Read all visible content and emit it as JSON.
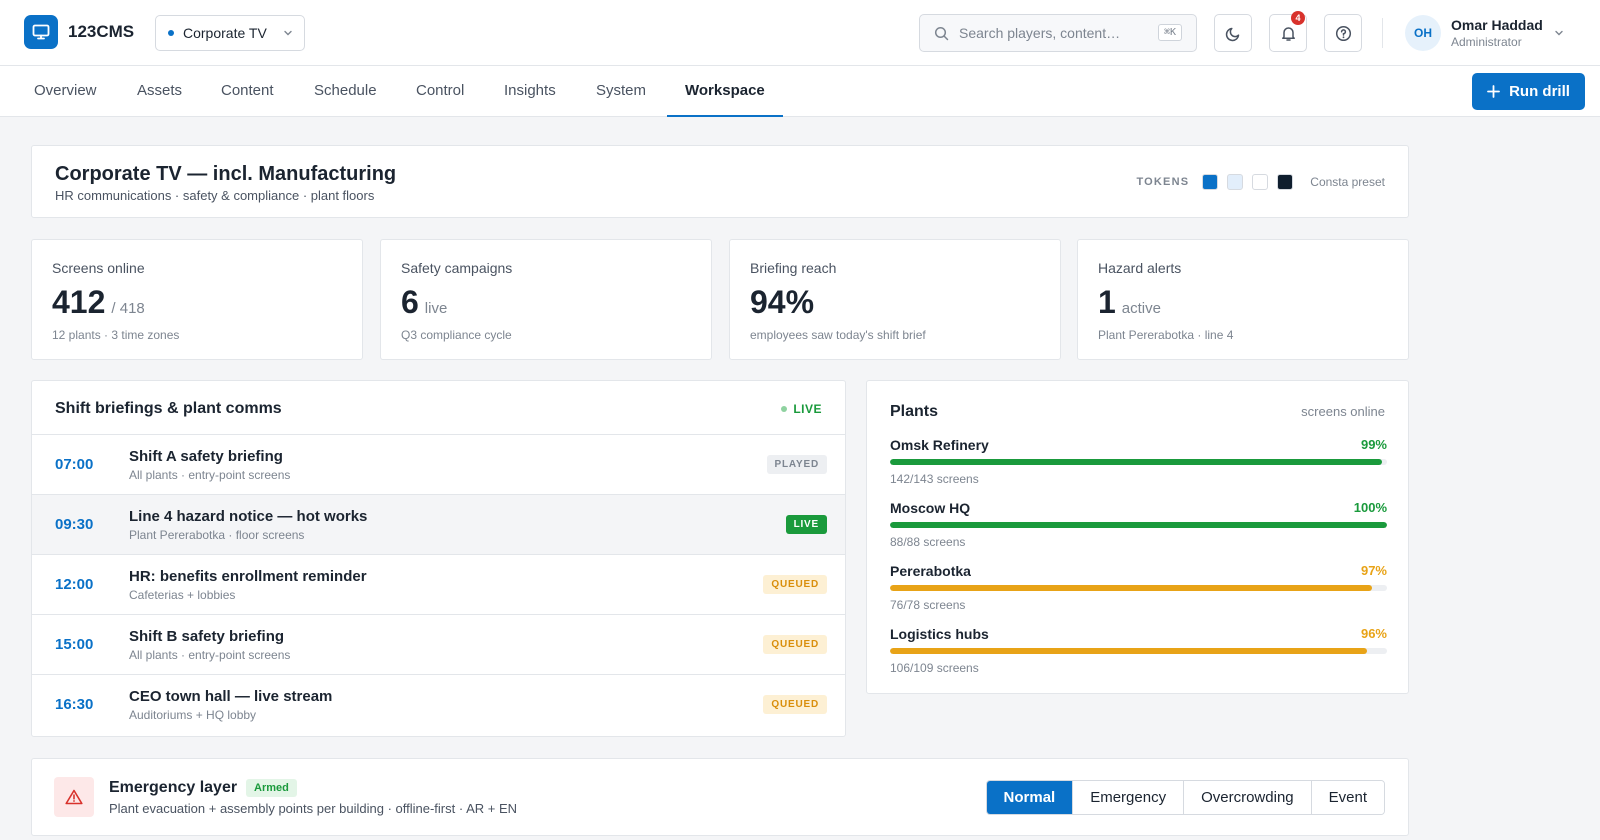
{
  "header": {
    "brand": "123CMS",
    "workspace": "Corporate TV",
    "search_placeholder": "Search players, content…",
    "search_shortcut": "⌘K",
    "notifications_count": "4",
    "user": {
      "initials": "OH",
      "name": "Omar Haddad",
      "role": "Administrator"
    }
  },
  "nav": {
    "tabs": [
      "Overview",
      "Assets",
      "Content",
      "Schedule",
      "Control",
      "Insights",
      "System",
      "Workspace"
    ],
    "active": "Workspace",
    "run_drill": "Run drill"
  },
  "workspace": {
    "title": "Corporate TV — incl. Manufacturing",
    "subtitle": "HR communications · safety & compliance · plant floors",
    "tokens_label": "TOKENS",
    "token_colors": [
      "#0a71c7",
      "#e2eefb",
      "#ffffff",
      "#0f1e2e"
    ],
    "preset": "Consta preset"
  },
  "stats": [
    {
      "label": "Screens online",
      "value": "412",
      "unit": "/ 418",
      "note": "12 plants · 3 time zones"
    },
    {
      "label": "Safety campaigns",
      "value": "6",
      "unit": "live",
      "note": "Q3 compliance cycle"
    },
    {
      "label": "Briefing reach",
      "value": "94%",
      "unit": "",
      "note": "employees saw today's shift brief"
    },
    {
      "label": "Hazard alerts",
      "value": "1",
      "unit": "active",
      "note": "Plant Pererabotka · line 4"
    }
  ],
  "briefings": {
    "title": "Shift briefings & plant comms",
    "live_label": "LIVE",
    "rows": [
      {
        "time": "07:00",
        "title": "Shift A safety briefing",
        "sub": "All plants · entry-point screens",
        "status": "PLAYED",
        "kind": "played"
      },
      {
        "time": "09:30",
        "title": "Line 4 hazard notice — hot works",
        "sub": "Plant Pererabotka · floor screens",
        "status": "LIVE",
        "kind": "live"
      },
      {
        "time": "12:00",
        "title": "HR: benefits enrollment reminder",
        "sub": "Cafeterias + lobbies",
        "status": "QUEUED",
        "kind": "queued"
      },
      {
        "time": "15:00",
        "title": "Shift B safety briefing",
        "sub": "All plants · entry-point screens",
        "status": "QUEUED",
        "kind": "queued"
      },
      {
        "time": "16:30",
        "title": "CEO town hall — live stream",
        "sub": "Auditoriums + HQ lobby",
        "status": "QUEUED",
        "kind": "queued"
      }
    ]
  },
  "plants": {
    "title": "Plants",
    "meta": "screens online",
    "items": [
      {
        "name": "Omsk Refinery",
        "pct": "99%",
        "fraction": 0.99,
        "screens": "142/143 screens",
        "color": "#1a9a3c"
      },
      {
        "name": "Moscow HQ",
        "pct": "100%",
        "fraction": 1.0,
        "screens": "88/88 screens",
        "color": "#1a9a3c"
      },
      {
        "name": "Pererabotka",
        "pct": "97%",
        "fraction": 0.97,
        "screens": "76/78 screens",
        "color": "#e8a317"
      },
      {
        "name": "Logistics hubs",
        "pct": "96%",
        "fraction": 0.96,
        "screens": "106/109 screens",
        "color": "#e8a317"
      }
    ]
  },
  "emergency": {
    "title": "Emergency layer",
    "badge": "Armed",
    "subtitle": "Plant evacuation + assembly points per building · offline-first · AR + EN",
    "modes": [
      "Normal",
      "Emergency",
      "Overcrowding",
      "Event"
    ],
    "active_mode": "Normal"
  }
}
